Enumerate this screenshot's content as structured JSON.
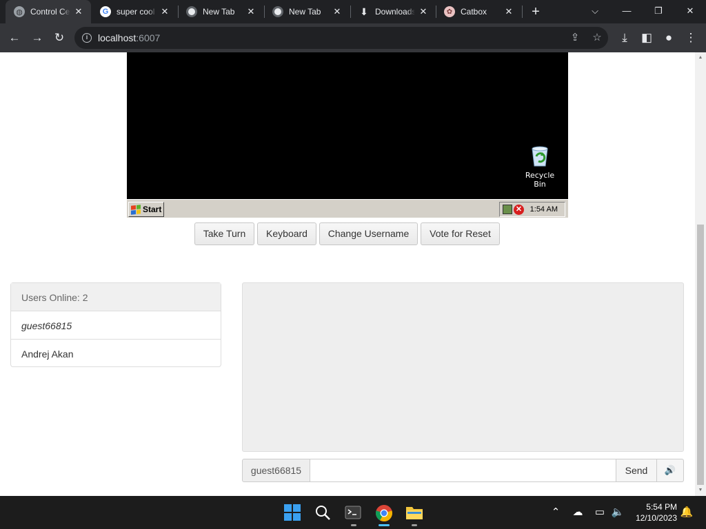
{
  "browser": {
    "tabs": [
      {
        "title": "Control Center",
        "icon": "globe-icon",
        "active": true
      },
      {
        "title": "super cool",
        "icon": "google-icon",
        "active": false
      },
      {
        "title": "New Tab",
        "icon": "chrome-icon",
        "active": false
      },
      {
        "title": "New Tab",
        "icon": "chrome-icon",
        "active": false
      },
      {
        "title": "Downloads",
        "icon": "download-icon",
        "active": false
      },
      {
        "title": "Catbox",
        "icon": "catbox-icon",
        "active": false
      }
    ],
    "new_tab_glyph": "+",
    "address": {
      "host": "localhost",
      "port": ":6007"
    },
    "accent": "#35363a"
  },
  "vm": {
    "desktop_icon_label": "Recycle Bin",
    "start_label": "Start",
    "clock": "1:54 AM"
  },
  "controls": {
    "take_turn": "Take Turn",
    "keyboard": "Keyboard",
    "change_username": "Change Username",
    "vote_reset": "Vote for Reset"
  },
  "users": {
    "header": "Users Online: 2",
    "list": [
      "guest66815",
      "Andrej Akan"
    ]
  },
  "chat": {
    "username": "guest66815",
    "input_value": "",
    "send_label": "Send",
    "sound_glyph": "🔊"
  },
  "taskbar": {
    "time": "5:54 PM",
    "date": "12/10/2023"
  }
}
